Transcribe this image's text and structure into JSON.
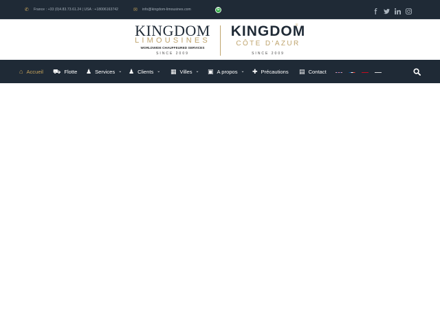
{
  "topbar": {
    "phone_text": "France : +33 (0)4.83.73.61.24 | USA : +18006163742",
    "email_text": "info@kingdom-limousines.com",
    "social": [
      "facebook-icon",
      "twitter-icon",
      "linkedin-icon",
      "instagram-icon"
    ]
  },
  "logo_left": {
    "name": "KINGDOM",
    "sub": "LIMOUSINES",
    "tagline": "WORLDWIDE CHAUFFEURED SERVICES",
    "since": "SINCE 2009"
  },
  "logo_right": {
    "name": "KINGDOM",
    "sub": "CÔTE D'AZUR",
    "since": "SINCE 2009"
  },
  "nav": {
    "items": [
      {
        "label": "Accueil",
        "icon": "home-icon"
      },
      {
        "label": "Flotte",
        "icon": "car-icon"
      },
      {
        "label": "Services",
        "icon": "chauffeur-icon"
      },
      {
        "label": "Clients",
        "icon": "users-icon"
      },
      {
        "label": "Villes",
        "icon": "building-icon"
      },
      {
        "label": "A propos",
        "icon": "id-card-icon"
      },
      {
        "label": "Précautions",
        "icon": "medkit-icon"
      },
      {
        "label": "Contact",
        "icon": "address-book-icon"
      }
    ],
    "languages": [
      "English",
      "Français",
      "Español",
      "Русский"
    ]
  },
  "colors": {
    "navy": "#1f2a36",
    "gold": "#c8a45c",
    "white": "#ffffff"
  }
}
